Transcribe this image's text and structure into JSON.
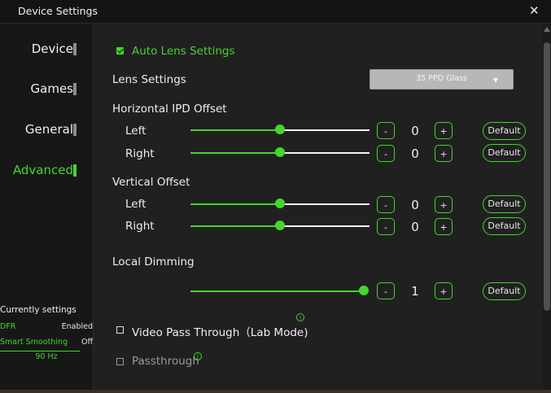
{
  "window": {
    "title": "Device Settings",
    "close_glyph": "✕"
  },
  "sidebar": {
    "items": [
      {
        "label": "Device"
      },
      {
        "label": "Games"
      },
      {
        "label": "General"
      },
      {
        "label": "Advanced",
        "active": true
      }
    ],
    "current": {
      "title": "Currently settings",
      "rows": [
        {
          "key": "DFR",
          "value": "Enabled"
        },
        {
          "key": "Smart Smoothing",
          "value": "Off"
        }
      ],
      "refresh": "90 Hz"
    }
  },
  "content": {
    "auto_lens": {
      "label": "Auto Lens Settings",
      "checked": true
    },
    "lens_settings": {
      "label": "Lens Settings",
      "selected": "35 PPD Glass",
      "arrow": "▼"
    },
    "horizontal_ipd": {
      "label": "Horizontal IPD Offset",
      "left": {
        "label": "Left",
        "value": "0",
        "level": 0.5
      },
      "right": {
        "label": "Right",
        "value": "0",
        "level": 0.5
      }
    },
    "vertical_offset": {
      "label": "Vertical Offset",
      "left": {
        "label": "Left",
        "value": "0",
        "level": 0.5
      },
      "right": {
        "label": "Right",
        "value": "0",
        "level": 0.5
      }
    },
    "local_dimming": {
      "label": "Local Dimming",
      "value": "1",
      "level": 1.0
    },
    "buttons": {
      "minus": "-",
      "plus": "+",
      "default": "Default"
    },
    "video_pass_through": {
      "label": "Video Pass Through（Lab Mode)",
      "checked": false
    },
    "passthrough": {
      "label": "Passthrough",
      "checked": false,
      "enabled": false
    },
    "info_glyph": "!"
  },
  "colors": {
    "accent": "#44d62c",
    "background": "#202020",
    "sidebar": "#171717"
  }
}
